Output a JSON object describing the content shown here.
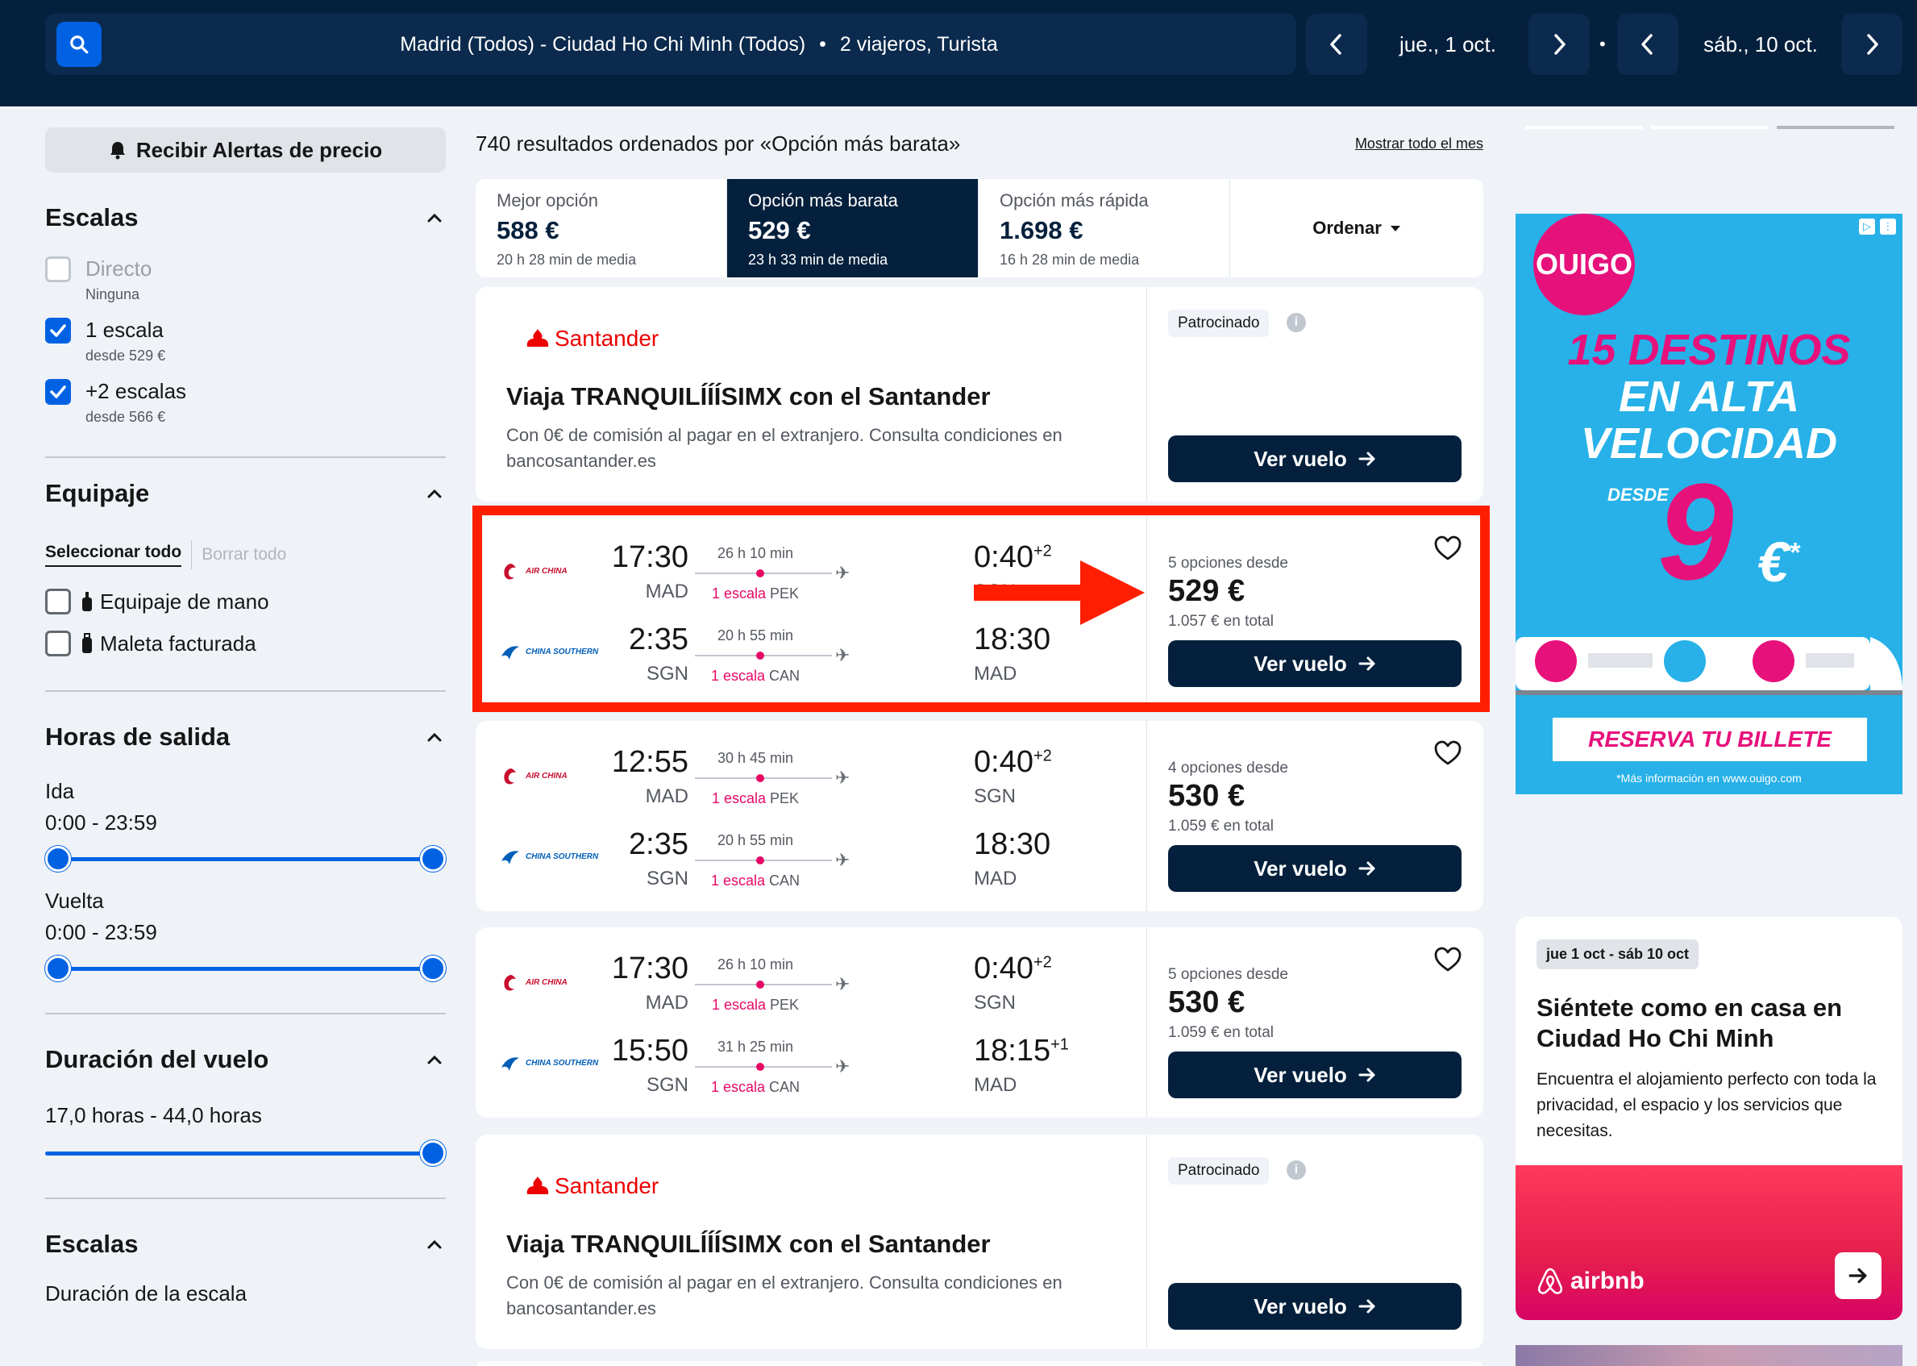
{
  "search": {
    "route": "Madrid (Todos) - Ciudad Ho Chi Minh (Todos)",
    "separator": "•",
    "travellers": "2 viajeros, Turista",
    "depart_date": "jue., 1 oct.",
    "return_date": "sáb., 10 oct."
  },
  "sidebar": {
    "price_alert": "Recibir Alertas de precio",
    "stops": {
      "title": "Escalas",
      "options": [
        {
          "label": "Directo",
          "sub": "Ninguna",
          "checked": false
        },
        {
          "label": "1 escala",
          "sub": "desde 529 €",
          "checked": true
        },
        {
          "label": "+2 escalas",
          "sub": "desde 566 €",
          "checked": true
        }
      ]
    },
    "baggage": {
      "title": "Equipaje",
      "select_all": "Seleccionar todo",
      "clear_all": "Borrar todo",
      "options": [
        {
          "label": "Equipaje de mano",
          "checked": false
        },
        {
          "label": "Maleta facturada",
          "checked": false
        }
      ]
    },
    "departure_times": {
      "title": "Horas de salida",
      "outbound_label": "Ida",
      "outbound_range": "0:00 - 23:59",
      "return_label": "Vuelta",
      "return_range": "0:00 - 23:59"
    },
    "duration": {
      "title": "Duración del vuelo",
      "range": "17,0 horas - 44,0 horas"
    },
    "layovers": {
      "title": "Escalas",
      "sub": "Duración de la escala"
    }
  },
  "results": {
    "count_text": "740 resultados ordenados por «Opción más barata»",
    "show_month": "Mostrar todo el mes",
    "sort_tabs": [
      {
        "label": "Mejor opción",
        "price": "588 €",
        "duration": "20 h 28 min de media",
        "active": false
      },
      {
        "label": "Opción más barata",
        "price": "529 €",
        "duration": "23 h 33 min de media",
        "active": true
      },
      {
        "label": "Opción más rápida",
        "price": "1.698 €",
        "duration": "16 h 28 min de media",
        "active": false
      }
    ],
    "order_label": "Ordenar"
  },
  "ad_santander": {
    "brand": "Santander",
    "sponsored": "Patrocinado",
    "info": "i",
    "title": "Viaja TRANQUILÍÍÍSIMX con el Santander",
    "desc": "Con 0€ de comisión al pagar en el extranjero. Consulta condiciones en bancosantander.es",
    "button": "Ver vuelo"
  },
  "flights": [
    {
      "outbound": {
        "airline": "AIR CHINA",
        "dep": "17:30",
        "dep_code": "MAD",
        "dur": "26 h 10 min",
        "stops": "1 escala",
        "via": "PEK",
        "arr": "0:40",
        "plus": "+2",
        "arr_code": "SGN"
      },
      "inbound": {
        "airline": "CHINA SOUTHERN",
        "dep": "2:35",
        "dep_code": "SGN",
        "dur": "20 h 55 min",
        "stops": "1 escala",
        "via": "CAN",
        "arr": "18:30",
        "plus": "",
        "arr_code": "MAD"
      },
      "options": "5 opciones desde",
      "price": "529 €",
      "total": "1.057 € en total",
      "button": "Ver vuelo"
    },
    {
      "outbound": {
        "airline": "AIR CHINA",
        "dep": "12:55",
        "dep_code": "MAD",
        "dur": "30 h 45 min",
        "stops": "1 escala",
        "via": "PEK",
        "arr": "0:40",
        "plus": "+2",
        "arr_code": "SGN"
      },
      "inbound": {
        "airline": "CHINA SOUTHERN",
        "dep": "2:35",
        "dep_code": "SGN",
        "dur": "20 h 55 min",
        "stops": "1 escala",
        "via": "CAN",
        "arr": "18:30",
        "plus": "",
        "arr_code": "MAD"
      },
      "options": "4 opciones desde",
      "price": "530 €",
      "total": "1.059 € en total",
      "button": "Ver vuelo"
    },
    {
      "outbound": {
        "airline": "AIR CHINA",
        "dep": "17:30",
        "dep_code": "MAD",
        "dur": "26 h 10 min",
        "stops": "1 escala",
        "via": "PEK",
        "arr": "0:40",
        "plus": "+2",
        "arr_code": "SGN"
      },
      "inbound": {
        "airline": "CHINA SOUTHERN",
        "dep": "15:50",
        "dep_code": "SGN",
        "dur": "31 h 25 min",
        "stops": "1 escala",
        "via": "CAN",
        "arr": "18:15",
        "plus": "+1",
        "arr_code": "MAD"
      },
      "options": "5 opciones desde",
      "price": "530 €",
      "total": "1.059 € en total",
      "button": "Ver vuelo"
    }
  ],
  "ad_ouigo": {
    "brand": "OUIGO",
    "line1": "15 DESTINOS",
    "line2": "EN ALTA",
    "line3": "VELOCIDAD",
    "desde": "DESDE",
    "price": "9",
    "currency": "€",
    "asterisk": "*",
    "cta": "RESERVA TU BILLETE",
    "footnote": "*Más información en www.ouigo.com"
  },
  "ad_airbnb": {
    "dates": "jue 1 oct - sáb 10 oct",
    "title": "Siéntete como en casa en Ciudad Ho Chi Minh",
    "desc": "Encuentra el alojamiento perfecto con toda la privacidad, el espacio y los servicios que necesitas.",
    "brand": "airbnb"
  },
  "colors": {
    "navy": "#05203c",
    "blue": "#0062e3",
    "pink": "#e70866",
    "highlight": "#ff1e00"
  }
}
